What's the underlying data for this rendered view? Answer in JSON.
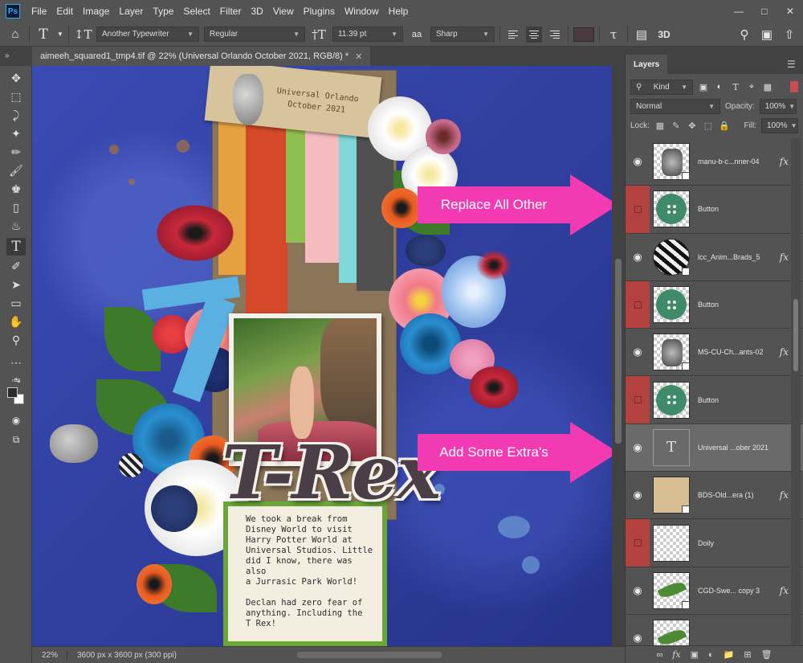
{
  "menubar": {
    "logo": "Ps",
    "items": [
      "File",
      "Edit",
      "Image",
      "Layer",
      "Type",
      "Select",
      "Filter",
      "3D",
      "View",
      "Plugins",
      "Window",
      "Help"
    ]
  },
  "options": {
    "font_family": "Another Typewriter",
    "font_style": "Regular",
    "font_size": "11.39 pt",
    "antialias": "Sharp",
    "antialias_icon": "aa"
  },
  "document": {
    "tab_title": "aimeeh_squared1_tmp4.tif @ 22% (Universal Orlando October 2021, RGB/8) *",
    "zoom": "22%",
    "dimensions": "3600 px x 3600 px (300 ppi)"
  },
  "canvas": {
    "tag_line1": "Universal Orlando",
    "tag_line2": "October 2021",
    "title": "T-Rex",
    "journal_para1": "We took a break from\nDisney World to visit\nHarry Potter World at\nUniversal Studios. Little\ndid I know, there was also\na Jurrasic Park World!",
    "journal_para2": "Declan had zero fear of\nanything. Including the\nT Rex!"
  },
  "callouts": {
    "top": "Replace All Other",
    "bottom": "Add Some Extra's"
  },
  "layers_panel": {
    "title": "Layers",
    "filter_kind": "Kind",
    "blend_mode": "Normal",
    "opacity_label": "Opacity:",
    "opacity_value": "100%",
    "lock_label": "Lock:",
    "fill_label": "Fill:",
    "fill_value": "100%",
    "layers": [
      {
        "name": "manu-b-c...nner-04",
        "visible": true,
        "fx": true,
        "thumb": "pattern"
      },
      {
        "name": "Button",
        "visible": false,
        "fx": false,
        "thumb": "button"
      },
      {
        "name": "lcc_Anim...Brads_5",
        "visible": true,
        "fx": true,
        "thumb": "zebra"
      },
      {
        "name": "Button",
        "visible": false,
        "fx": false,
        "thumb": "button"
      },
      {
        "name": "MS-CU-Ch...ants-02",
        "visible": true,
        "fx": true,
        "thumb": "pattern"
      },
      {
        "name": "Button",
        "visible": false,
        "fx": false,
        "thumb": "button"
      },
      {
        "name": "Universal ...ober 2021",
        "visible": true,
        "fx": false,
        "thumb": "text",
        "selected": true
      },
      {
        "name": "BDS-Old...era (1)",
        "visible": true,
        "fx": true,
        "thumb": "tag"
      },
      {
        "name": "Doily",
        "visible": false,
        "fx": false,
        "thumb": "plain"
      },
      {
        "name": "CGD-Swe... copy 3",
        "visible": true,
        "fx": true,
        "thumb": "leaf"
      },
      {
        "name": "",
        "visible": true,
        "fx": false,
        "thumb": "leaf"
      }
    ],
    "fx_glyph": "fx",
    "text_glyph": "T"
  },
  "colors": {
    "callout": "#f23bb2",
    "hidden_layer": "#b3423f",
    "canvas_blue": "#2f3fa0"
  }
}
